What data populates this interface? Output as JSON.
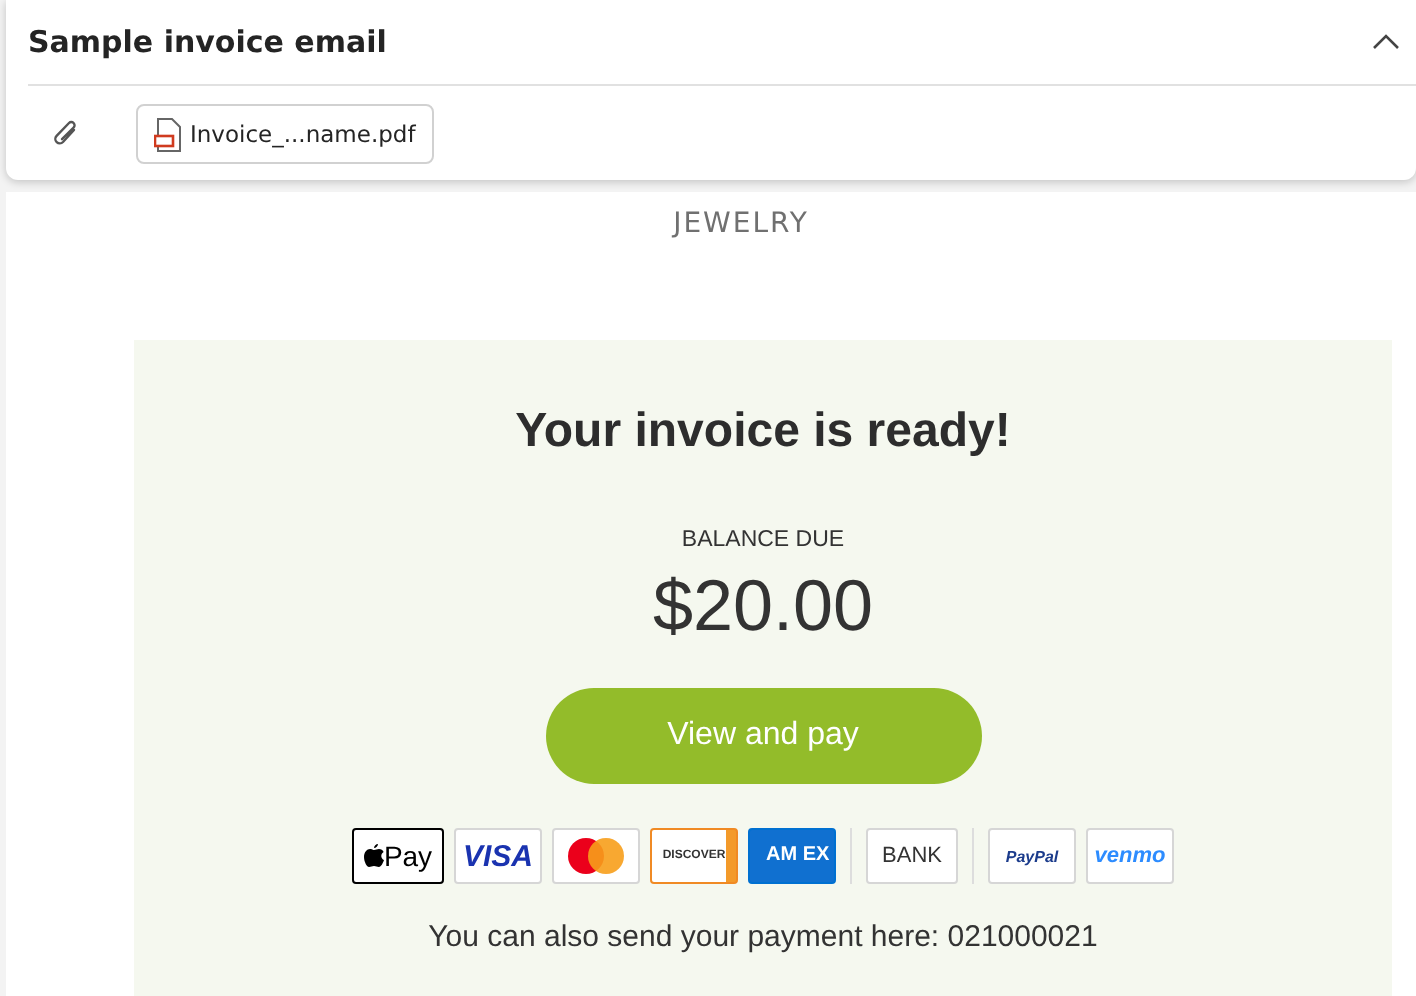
{
  "header": {
    "title": "Sample invoice email",
    "expanded": true,
    "attachments": [
      {
        "name": "Invoice_...name.pdf"
      }
    ]
  },
  "email": {
    "brand": "JEWELRY",
    "heading": "Your invoice is ready!",
    "balance_label": "BALANCE DUE",
    "amount": "$20.00",
    "button": "View and pay",
    "payment_methods": [
      {
        "kind": "applepay",
        "label": "Pay"
      },
      {
        "kind": "visa",
        "label": "VISA"
      },
      {
        "kind": "mastercard"
      },
      {
        "kind": "discover",
        "label": "DISCOVER"
      },
      {
        "kind": "amex",
        "label": "AM EX"
      },
      {
        "kind": "separator"
      },
      {
        "kind": "bank",
        "label": "BANK"
      },
      {
        "kind": "separator"
      },
      {
        "kind": "paypal",
        "label": "PayPal"
      },
      {
        "kind": "venmo",
        "label": "venmo"
      }
    ],
    "footer": "You can also send your payment here: 021000021"
  }
}
